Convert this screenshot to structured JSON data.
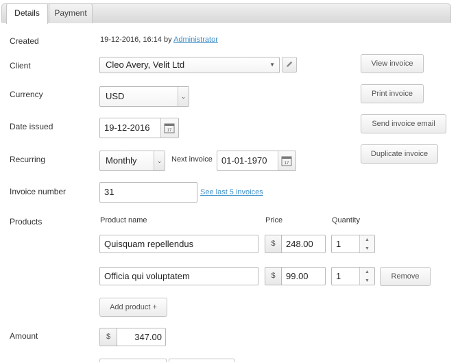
{
  "tabs": [
    "Details",
    "Payment"
  ],
  "created": {
    "label": "Created",
    "value": "19-12-2016, 16:14",
    "by": "by",
    "user": "Administrator"
  },
  "client": {
    "label": "Client",
    "value": "Cleo Avery, Velit Ltd"
  },
  "currency": {
    "label": "Currency",
    "value": "USD"
  },
  "date_issued": {
    "label": "Date issued",
    "value": "19-12-2016"
  },
  "recurring": {
    "label": "Recurring",
    "value": "Monthly",
    "next_label": "Next invoice",
    "next_value": "01-01-1970"
  },
  "invoice_number": {
    "label": "Invoice number",
    "value": "31",
    "link": "See last 5 invoices"
  },
  "products": {
    "label": "Products",
    "headers": {
      "name": "Product name",
      "price": "Price",
      "quantity": "Quantity"
    },
    "currency_symbol": "$",
    "rows": [
      {
        "name": "Quisquam repellendus",
        "price": "248.00",
        "quantity": "1"
      },
      {
        "name": "Officia qui voluptatem",
        "price": "99.00",
        "quantity": "1",
        "remove": "Remove"
      }
    ],
    "add_label": "Add product +"
  },
  "amount": {
    "label": "Amount",
    "symbol": "$",
    "value": "347.00"
  },
  "actions": [
    "View invoice",
    "Print invoice",
    "Send invoice email",
    "Duplicate invoice"
  ],
  "icons": {
    "pencil": "pencil-icon",
    "calendar": "calendar-icon",
    "dropdown": "chevron-down-icon"
  }
}
